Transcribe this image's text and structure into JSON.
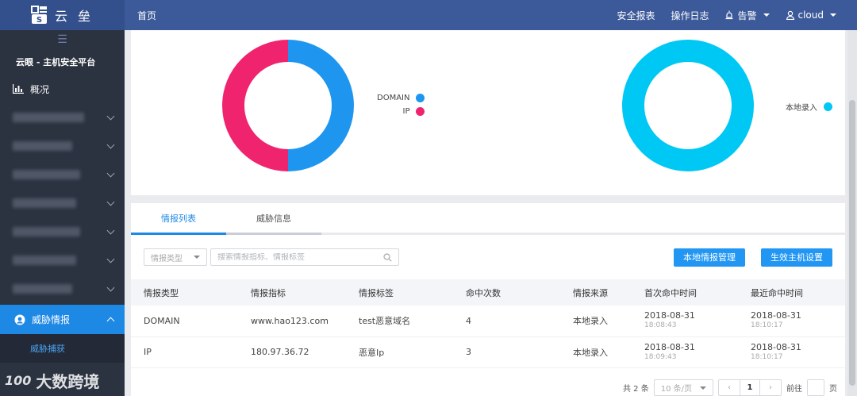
{
  "brand": {
    "name": "云 垒"
  },
  "topbar": {
    "home": "首页",
    "security_report": "安全报表",
    "operation_log": "操作日志",
    "alerts": "告警",
    "user": "cloud"
  },
  "sidebar": {
    "menu_glyph": "☰",
    "platform_title": "云眼 - 主机安全平台",
    "overview": "概况",
    "active_item": "威胁情报",
    "sub_item": "威胁捕获"
  },
  "donut_left": {
    "segments": [
      {
        "label": "DOMAIN",
        "value": 1,
        "color": "#1e96f0"
      },
      {
        "label": "IP",
        "value": 1,
        "color": "#f0246e"
      }
    ]
  },
  "donut_right": {
    "segments": [
      {
        "label": "本地录入",
        "value": 2,
        "color": "#00c8f5"
      }
    ]
  },
  "tabs": [
    "情报列表",
    "威胁信息"
  ],
  "toolbar": {
    "type_select": "情报类型",
    "search_placeholder": "搜索情报指标、情报标签",
    "btn_local": "本地情报管理",
    "btn_host": "生效主机设置"
  },
  "table": {
    "headers": [
      "情报类型",
      "情报指标",
      "情报标签",
      "命中次数",
      "情报来源",
      "首次命中时间",
      "最近命中时间"
    ],
    "rows": [
      {
        "type": "DOMAIN",
        "indicator": "www.hao123.com",
        "tag": "test恶意域名",
        "hits": "4",
        "source": "本地录入",
        "first_date": "2018-08-31",
        "first_time": "18:08:43",
        "last_date": "2018-08-31",
        "last_time": "18:10:17"
      },
      {
        "type": "IP",
        "indicator": "180.97.36.72",
        "tag": "恶意Ip",
        "hits": "3",
        "source": "本地录入",
        "first_date": "2018-08-31",
        "first_time": "18:09:43",
        "last_date": "2018-08-31",
        "last_time": "18:10:17"
      }
    ]
  },
  "pager": {
    "total": "共 2 条",
    "page_size": "10 条/页",
    "current": "1",
    "goto": "前往",
    "page_unit": "页"
  },
  "watermark": {
    "logo": "100",
    "text": "大数跨境"
  }
}
